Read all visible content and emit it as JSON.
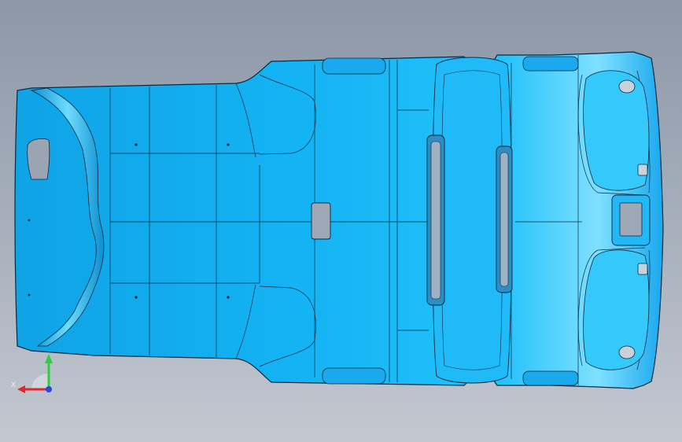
{
  "viewport": {
    "background_top": "#8c97a8",
    "background_bottom": "#c3c8d0"
  },
  "model": {
    "part": "headliner-panel",
    "fill_color": "#12b3f2",
    "highlight_color": "#7fe0ff",
    "edge_color": "#0b2a3d"
  },
  "triad": {
    "x_label": "X",
    "x_color": "#e0282b",
    "y_color": "#2bcf3f",
    "z_color": "#2a49d9"
  }
}
